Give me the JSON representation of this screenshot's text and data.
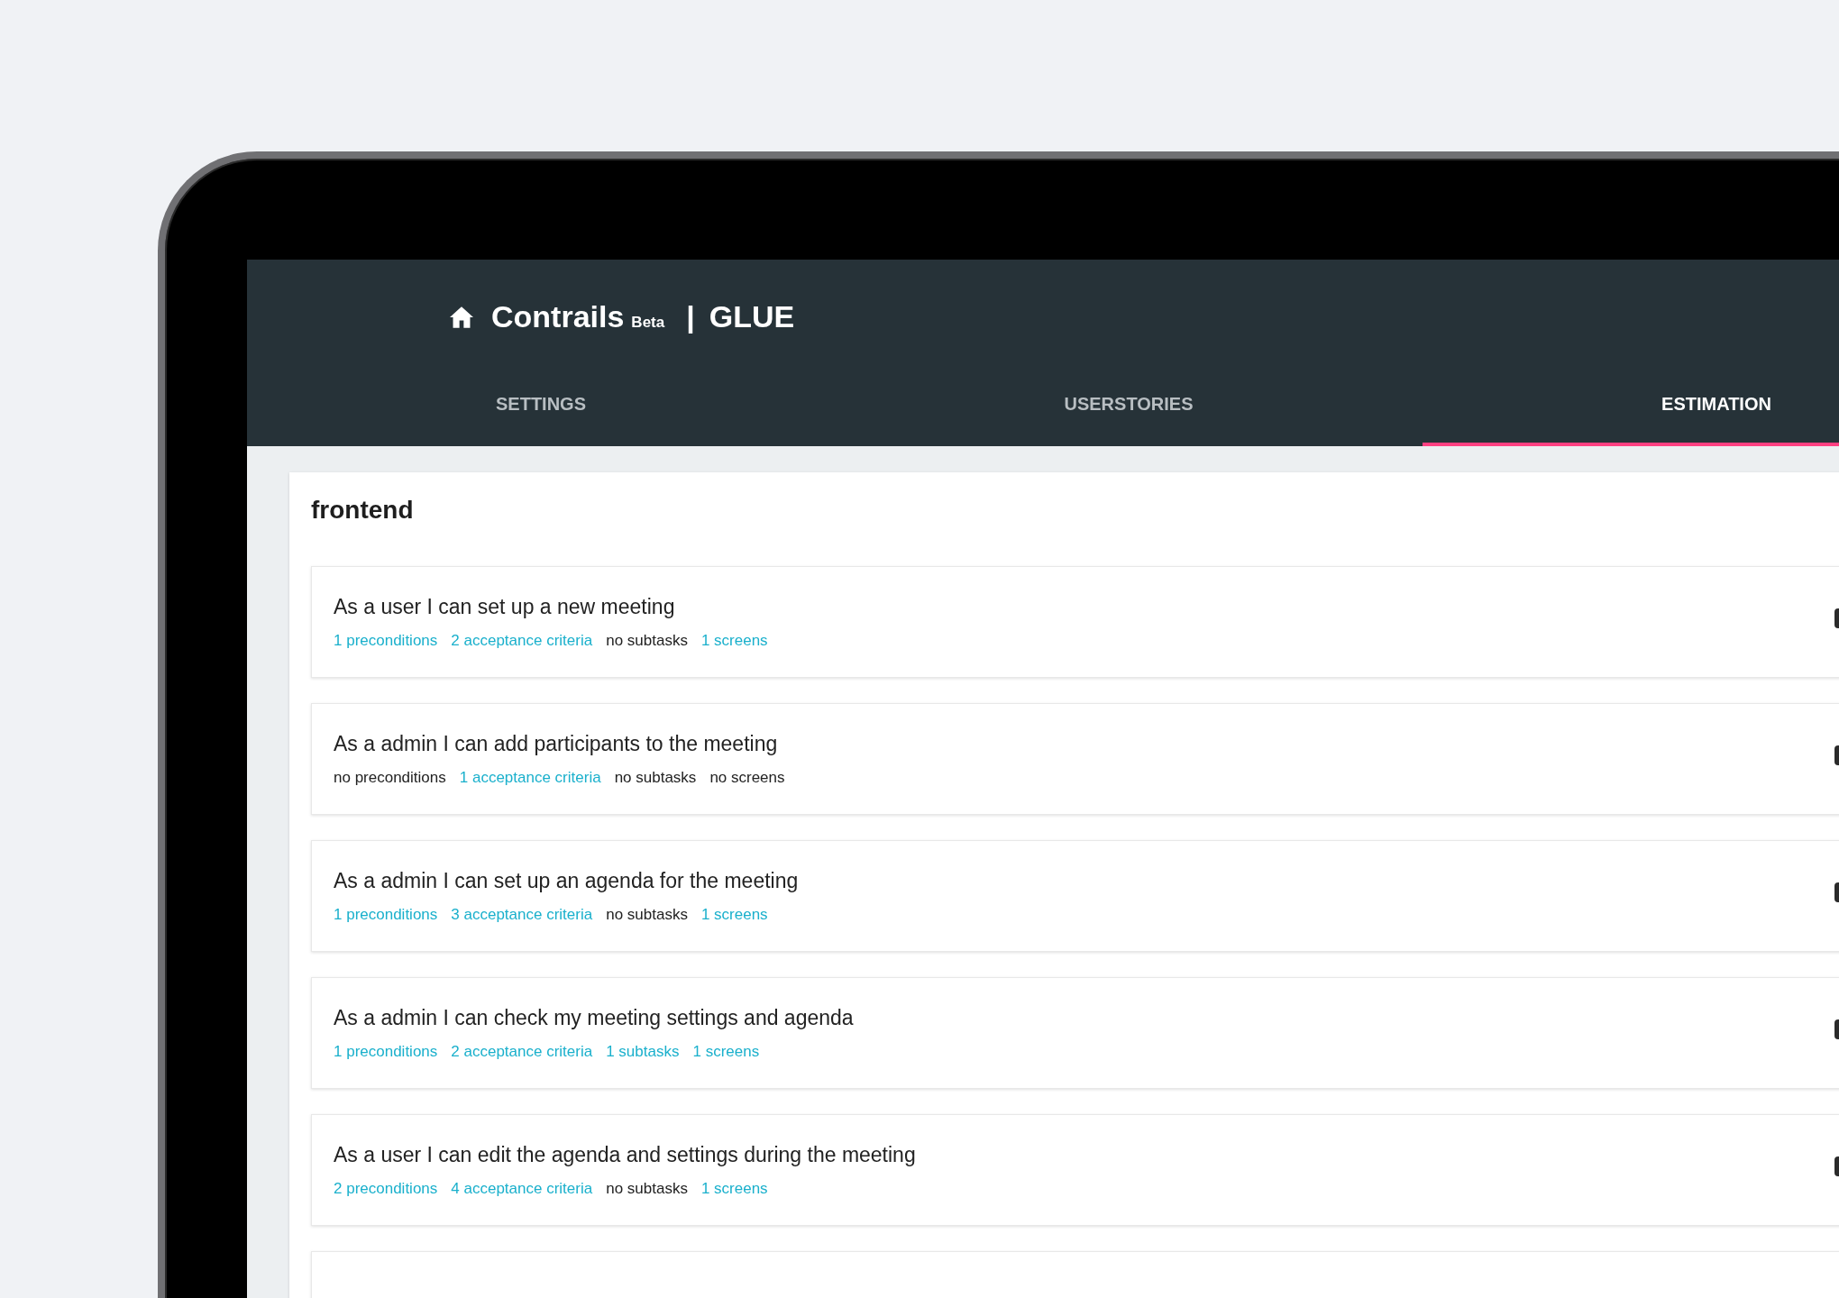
{
  "header": {
    "app_name": "Contrails",
    "badge": "Beta",
    "separator": "|",
    "project": "GLUE"
  },
  "tabs": [
    {
      "label": "SETTINGS",
      "selected": false
    },
    {
      "label": "USERSTORIES",
      "selected": false
    },
    {
      "label": "ESTIMATION",
      "selected": true
    }
  ],
  "section": {
    "title": "frontend",
    "more_below": true,
    "stories": [
      {
        "title": "As a user I can set up a new meeting",
        "meta": [
          {
            "text": "1 preconditions",
            "kind": "link"
          },
          {
            "text": "2 acceptance criteria",
            "kind": "link"
          },
          {
            "text": "no subtasks",
            "kind": "plain"
          },
          {
            "text": "1 screens",
            "kind": "link"
          }
        ]
      },
      {
        "title": "As a admin I can add participants to the meeting",
        "meta": [
          {
            "text": "no preconditions",
            "kind": "plain"
          },
          {
            "text": "1 acceptance criteria",
            "kind": "link"
          },
          {
            "text": "no subtasks",
            "kind": "plain"
          },
          {
            "text": "no screens",
            "kind": "plain"
          }
        ]
      },
      {
        "title": "As a admin I can set up an agenda for the meeting",
        "meta": [
          {
            "text": "1 preconditions",
            "kind": "link"
          },
          {
            "text": "3 acceptance criteria",
            "kind": "link"
          },
          {
            "text": "no subtasks",
            "kind": "plain"
          },
          {
            "text": "1 screens",
            "kind": "link"
          }
        ]
      },
      {
        "title": "As a admin I can check my meeting settings and agenda",
        "meta": [
          {
            "text": "1 preconditions",
            "kind": "link"
          },
          {
            "text": "2 acceptance criteria",
            "kind": "link"
          },
          {
            "text": "1 subtasks",
            "kind": "link"
          },
          {
            "text": "1 screens",
            "kind": "link"
          }
        ]
      },
      {
        "title": "As a user I can edit the agenda and settings during the meeting",
        "meta": [
          {
            "text": "2 preconditions",
            "kind": "link"
          },
          {
            "text": "4 acceptance criteria",
            "kind": "link"
          },
          {
            "text": "no subtasks",
            "kind": "plain"
          },
          {
            "text": "1 screens",
            "kind": "link"
          }
        ]
      }
    ]
  }
}
